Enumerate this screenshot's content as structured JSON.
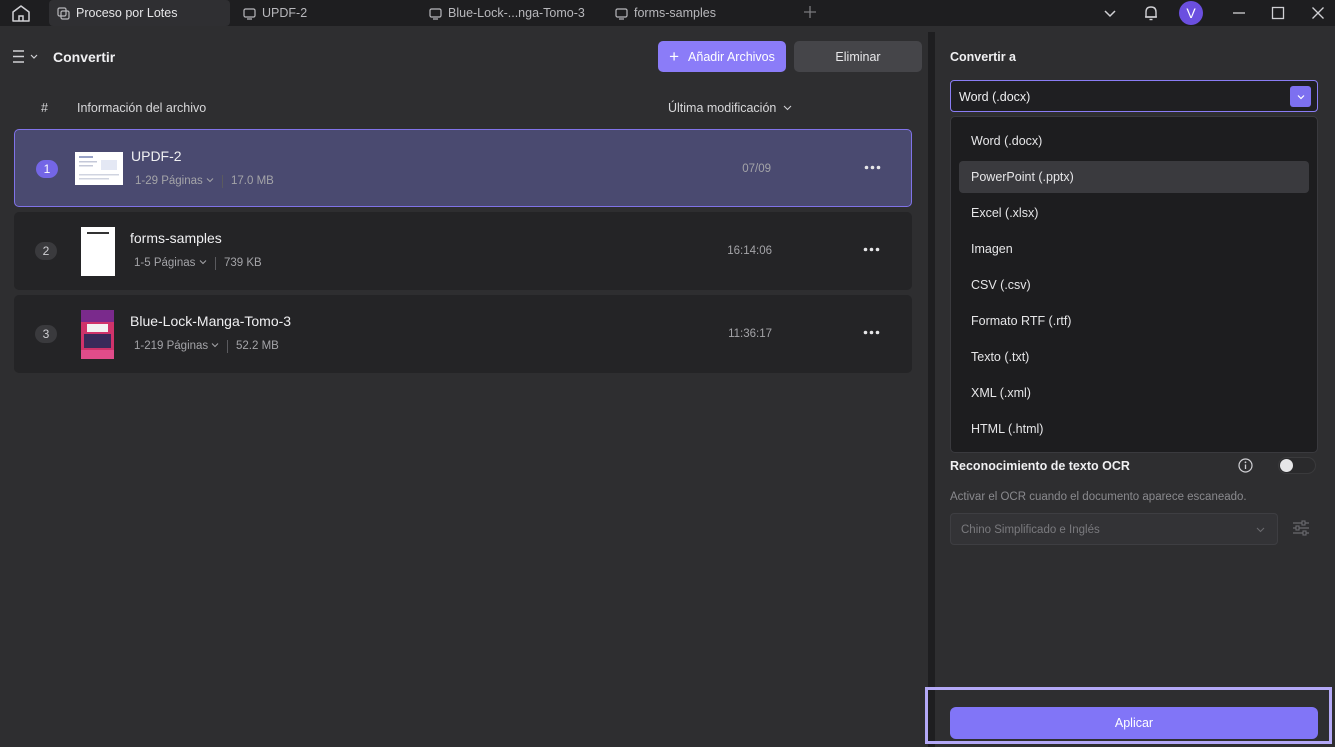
{
  "tabs": [
    {
      "label": "Proceso por Lotes",
      "icon": "batch-icon",
      "active": true
    },
    {
      "label": "UPDF-2",
      "icon": "document-tab-icon",
      "active": false
    },
    {
      "label": "Blue-Lock-...nga-Tomo-3",
      "icon": "document-tab-icon",
      "active": false
    },
    {
      "label": "forms-samples",
      "icon": "document-tab-icon",
      "active": false
    }
  ],
  "user": {
    "avatar_initial": "V",
    "avatar_color": "#6b4fe0"
  },
  "toolbar": {
    "section_title": "Convertir",
    "add_label": "Añadir Archivos",
    "delete_label": "Eliminar"
  },
  "table": {
    "headers": {
      "index": "#",
      "info": "Información del archivo",
      "modified": "Última modificación"
    },
    "rows": [
      {
        "index": "1",
        "name": "UPDF-2",
        "pages": "1-29 Páginas",
        "size": "17.0 MB",
        "modified": "07/09",
        "selected": true
      },
      {
        "index": "2",
        "name": "forms-samples",
        "pages": "1-5 Páginas",
        "size": "739 KB",
        "modified": "16:14:06",
        "selected": false
      },
      {
        "index": "3",
        "name": "Blue-Lock-Manga-Tomo-3",
        "pages": "1-219 Páginas",
        "size": "52.2 MB",
        "modified": "11:36:17",
        "selected": false
      }
    ]
  },
  "convert": {
    "title": "Convertir a",
    "selected": "Word (.docx)",
    "options": [
      "Word (.docx)",
      "PowerPoint (.pptx)",
      "Excel (.xlsx)",
      "Imagen",
      "CSV (.csv)",
      "Formato RTF (.rtf)",
      "Texto (.txt)",
      "XML (.xml)",
      "HTML (.html)"
    ],
    "hovered_option": "PowerPoint (.pptx)"
  },
  "ocr": {
    "label": "Reconocimiento de texto OCR",
    "description": "Activar el OCR cuando el documento aparece escaneado.",
    "enabled": false,
    "language": "Chino Simplificado e Inglés"
  },
  "apply_label": "Aplicar",
  "colors": {
    "accent": "#8175f7",
    "selected_row": "#4a4a70"
  }
}
